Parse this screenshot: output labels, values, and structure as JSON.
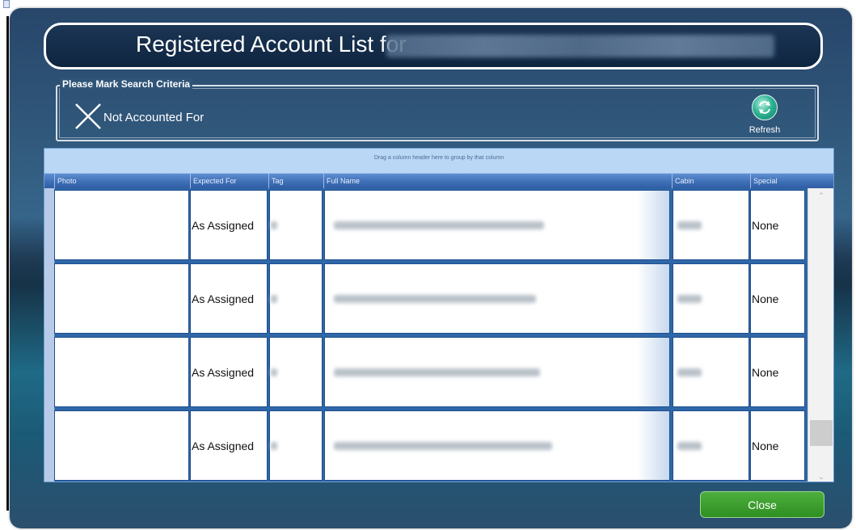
{
  "window": {
    "title": "Registered Account List for"
  },
  "criteria": {
    "legend": "Please Mark Search Criteria",
    "checkbox_label": "Not Accounted For",
    "checked": true,
    "refresh_label": "Refresh"
  },
  "grid": {
    "group_hint": "Drag a column header here to group by that column",
    "columns": [
      "Photo",
      "Expected For",
      "Tag",
      "Full Name",
      "Cabin",
      "Special"
    ],
    "rows": [
      {
        "expected_for": "As Assigned",
        "special": "None"
      },
      {
        "expected_for": "As Assigned",
        "special": "None"
      },
      {
        "expected_for": "As Assigned",
        "special": "None"
      },
      {
        "expected_for": "As Assigned",
        "special": "None"
      }
    ]
  },
  "footer": {
    "close_label": "Close"
  },
  "colors": {
    "header_blue": "#3f6fb6",
    "close_green": "#2f8f22",
    "refresh_teal": "#2fb493"
  },
  "icons": [
    "close-x-icon",
    "refresh-icon",
    "scroll-up-icon",
    "scroll-down-icon"
  ]
}
